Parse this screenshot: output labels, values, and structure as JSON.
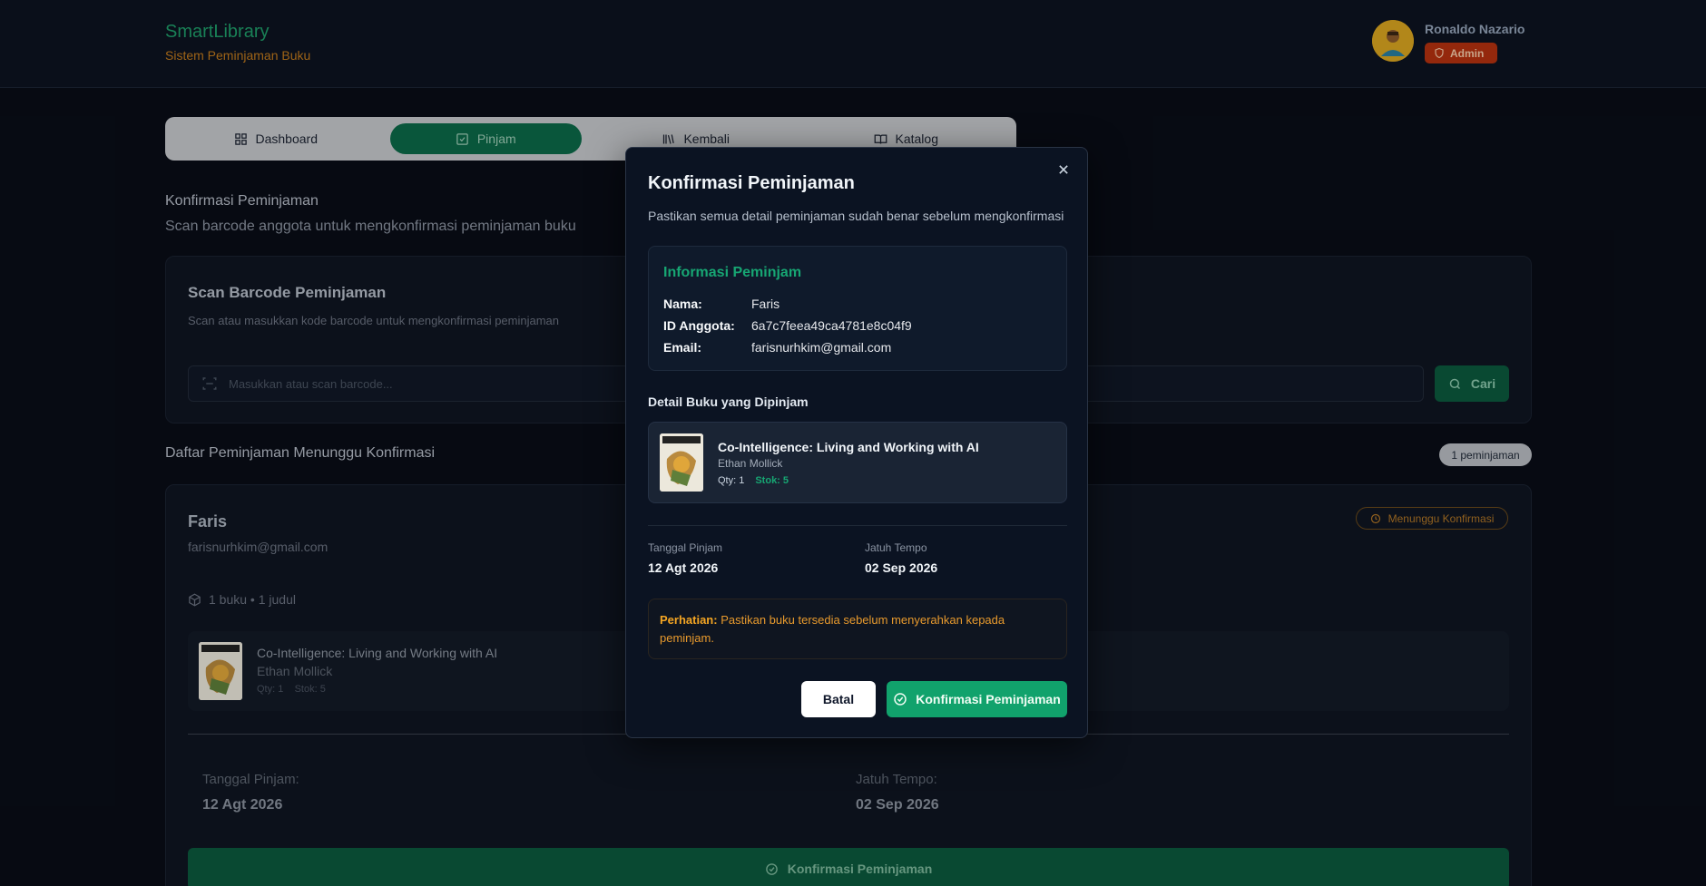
{
  "header": {
    "brand_title": "SmartLibrary",
    "brand_subtitle": "Sistem Peminjaman Buku",
    "user_name": "Ronaldo Nazario",
    "role_badge": "Admin"
  },
  "tabs": [
    {
      "label": "Dashboard",
      "icon": "grid-icon",
      "active": false
    },
    {
      "label": "Pinjam",
      "icon": "check-square-icon",
      "active": true
    },
    {
      "label": "Kembali",
      "icon": "library-icon",
      "active": false
    },
    {
      "label": "Katalog",
      "icon": "book-open-icon",
      "active": false
    }
  ],
  "page": {
    "title": "Konfirmasi Peminjaman",
    "subtitle": "Scan barcode anggota untuk mengkonfirmasi peminjaman buku"
  },
  "scan": {
    "title": "Scan Barcode Peminjaman",
    "subtitle": "Scan atau masukkan kode barcode untuk mengkonfirmasi peminjaman",
    "placeholder": "Masukkan atau scan barcode...",
    "button": "Cari"
  },
  "list": {
    "title": "Daftar Peminjaman Menunggu Konfirmasi",
    "count": "1 peminjaman"
  },
  "loan": {
    "name": "Faris",
    "email": "farisnurhkim@gmail.com",
    "status": "Menunggu Konfirmasi",
    "meta": "1 buku • 1 judul",
    "book_title": "Co-Intelligence: Living and Working with AI",
    "book_author": "Ethan Mollick",
    "book_qty": "Qty: 1",
    "book_stock": "Stok: 5",
    "loan_date_label": "Tanggal Pinjam:",
    "loan_date": "12 Agt 2026",
    "due_date_label": "Jatuh Tempo:",
    "due_date": "02 Sep 2026",
    "confirm_button": "Konfirmasi Peminjaman"
  },
  "modal": {
    "title": "Konfirmasi Peminjaman",
    "subtitle": "Pastikan semua detail peminjaman sudah benar sebelum mengkonfirmasi",
    "info_title": "Informasi Peminjam",
    "name_label": "Nama:",
    "name": "Faris",
    "id_label": "ID Anggota:",
    "id": "6a7c7feea49ca4781e8c04f9",
    "email_label": "Email:",
    "email": "farisnurhkim@gmail.com",
    "books_title": "Detail Buku yang Dipinjam",
    "book_title": "Co-Intelligence: Living and Working with AI",
    "book_author": "Ethan Mollick",
    "book_qty": "Qty: 1",
    "book_stock": "Stok: 5",
    "loan_date_label": "Tanggal Pinjam",
    "loan_date": "12 Agt 2026",
    "due_date_label": "Jatuh Tempo",
    "due_date": "02 Sep 2026",
    "warning_label": "Perhatian:",
    "warning_text": "Pastikan buku tersedia sebelum menyerahkan kepada peminjam.",
    "cancel_button": "Batal",
    "confirm_button": "Konfirmasi Peminjaman"
  },
  "colors": {
    "brand_green": "#1f9d6a",
    "accent_orange": "#c27a1d",
    "admin_red": "#b5310f",
    "confirm_green": "#11a26c",
    "background": "#090d17"
  }
}
